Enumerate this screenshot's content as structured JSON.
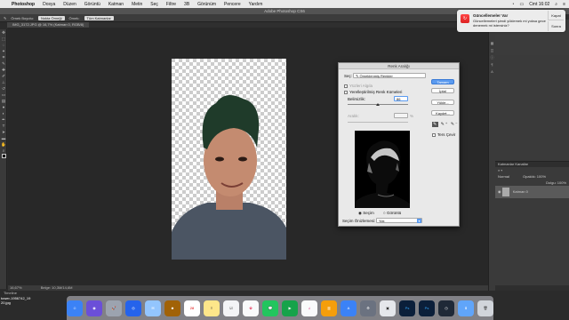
{
  "menubar": {
    "apple": "",
    "app": "Photoshop",
    "items": [
      "Dosya",
      "Düzen",
      "Görüntü",
      "Katman",
      "Metin",
      "Seç",
      "Filtre",
      "3B",
      "Görünüm",
      "Pencere",
      "Yardım"
    ],
    "clock": "Cmt 16:02"
  },
  "window": {
    "title": "Adobe Photoshop CS6"
  },
  "options": {
    "refine": "Örnek Boyutu:",
    "sample": "Nokta Örneği",
    "layers": "Örnek:",
    "layers_val": "Tüm Katmanlar"
  },
  "doc": {
    "tab": "IMG_3172.JPG @ 16,7% (Katman 0, RGB/8)",
    "zoom": "16,67%",
    "status": "Belge: 10,3M/14,6M"
  },
  "mini": {
    "label": "Timeline"
  },
  "notification": {
    "title": "Güncellemeler Var",
    "message": "Güncellemeleri şimdi yüklemek mi yoksa gece denemek mi istersiniz?",
    "btn1": "Kapat",
    "btn2": "Sonra",
    "icon": "update-icon"
  },
  "right": {
    "top_label": "Özellik Yok",
    "layers_tabs": "Katmanlar  Kanallar",
    "blend": "Normal",
    "opacity": "Opaklık: 100%",
    "fill": "Dolgu: 100%",
    "layer_name": "Katman 0"
  },
  "dialog": {
    "title": "Renk Aralığı",
    "select_label": "Seç:",
    "select_value": "Örneklenmiş Renkler",
    "detect_faces": "Yüzleri Algıla",
    "localized": "Yerelleştirilmiş Renk Kümeleri",
    "fuzziness_label": "Belirsizlik:",
    "fuzziness_value": "86",
    "range_label": "Aralık:",
    "range_unit": "%",
    "ok": "Tamam",
    "cancel": "İptal",
    "load": "Yükle...",
    "save": "Kaydet...",
    "invert": "Ters Çevir",
    "radio_selection": "Seçim",
    "radio_image": "Görüntü",
    "preview_label": "Seçim Önizlemesi:",
    "preview_value": "Yok"
  },
  "desktop": {
    "file": "tower-1956742_19",
    "file2": "20.jpg"
  },
  "dock": [
    "Finder",
    "Siri",
    "Launchpad",
    "Safari",
    "Mail",
    "Contacts",
    "Calendar",
    "Notes",
    "Reminders",
    "Photos",
    "Messages",
    "FaceTime",
    "iTunes",
    "iBooks",
    "App Store",
    "System Preferences",
    "Preview",
    "Photoshop",
    "Photoshop",
    "Activity",
    "Downloads",
    "Trash"
  ],
  "colors": {
    "accent": "#5b9bf0",
    "panel": "#3a3a3a",
    "canvas": "#282828"
  }
}
